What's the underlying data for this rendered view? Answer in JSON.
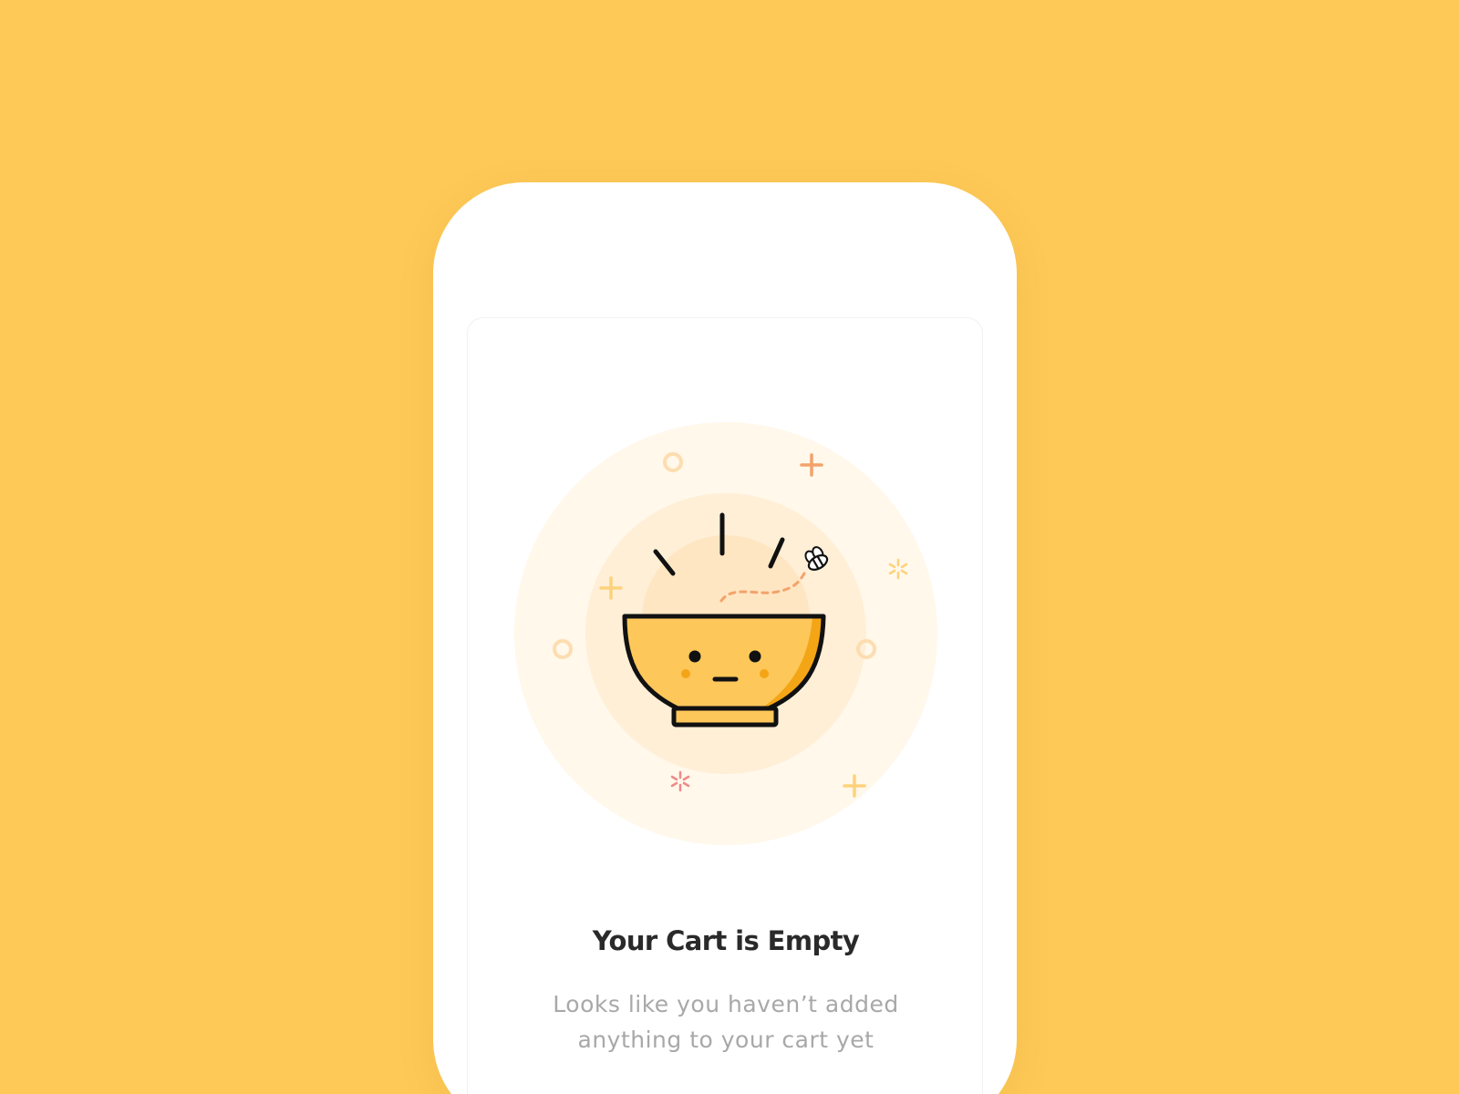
{
  "colors": {
    "background": "#FEC957",
    "bowl_fill": "#FDC75A",
    "bowl_shade": "#F4A516",
    "outline": "#111111",
    "halo_outer": "#FFF8EB",
    "halo_mid": "#FFEFD7",
    "halo_inner": "#FFE6C2",
    "accent_orange": "#F4A26B",
    "accent_pink": "#EE8A8A",
    "title_text": "#2A2A2A",
    "body_text": "#A8A8A8"
  },
  "illustration": {
    "name": "empty-bowl-illustration",
    "icons": [
      "bowl-icon",
      "bee-icon",
      "sparkle-icon",
      "plus-icon",
      "ring-icon"
    ]
  },
  "empty_state": {
    "title": "Your Cart is Empty",
    "message_line1": "Looks like you haven’t added",
    "message_line2": "anything to your cart yet"
  }
}
